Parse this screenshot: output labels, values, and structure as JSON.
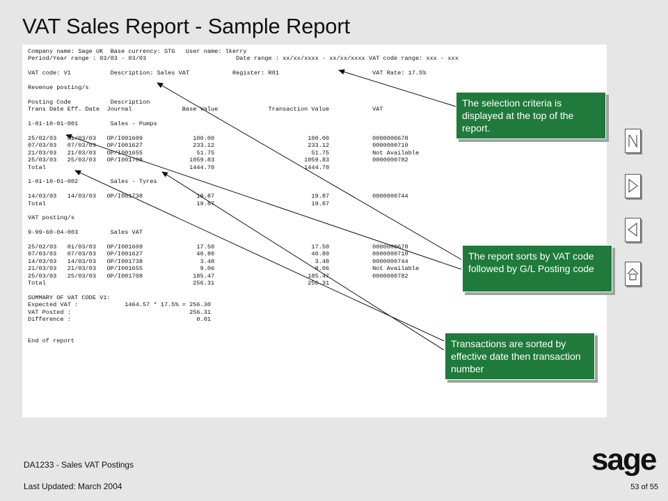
{
  "title": "VAT Sales Report - Sample Report",
  "report_lines": [
    "Company name: Sage UK  Base currency: STG   User name: lkerry",
    "Period/Year range : 03/03 - 03/03                         Date range : xx/xx/xxxx - xx/xx/xxxx VAT code range: xxx - xxx",
    "",
    "VAT code: V1           Description: Sales VAT            Register: R01                          VAT Rate: 17.5%",
    "",
    "Revenue posting/s",
    "",
    "Posting Code           Description",
    "Trans Date Eff. Date  Journal              Base Value              Transaction Value            VAT",
    "",
    "1-01-10-01-001         Sales - Pumps",
    "",
    "25/02/03   01/03/03   OP/I001609              100.00                          100.00            0000000678",
    "07/03/03   07/03/03   OP/I001627              233.12                          233.12            0000000710",
    "21/03/03   21/03/03   OP/I001655               51.75                           51.75            Not Available",
    "25/03/03   25/03/03   OP/I001708             1059.83                         1059.83            0000000782",
    "Total                                        1444.70                         1444.70",
    "",
    "1-01-10-01-002         Sales - Tyres",
    "",
    "14/03/03   14/03/03   OP/I001738               19.87                           19.87            0000000744",
    "Total                                          19.87                           19.87",
    "",
    "VAT posting/s",
    "",
    "9-99-60-04-003         Sales VAT",
    "",
    "25/02/03   01/03/03   OP/I001609               17.50                           17.50            0000000678",
    "07/03/03   07/03/03   OP/I001627               40.80                           40.80            0000000710",
    "14/03/03   14/03/03   OP/I001738                3.48                            3.48            0000000744",
    "21/03/03   21/03/03   OP/I001655                9.06                            9.06            Not Available",
    "25/03/03   25/03/03   OP/I001708              185.47                          185.47            0000000782",
    "Total                                         256.31                          256.31",
    "",
    "SUMMARY OF VAT CODE V1:",
    "Expected VAT :             1464.57 * 17.5% = 256.30",
    "VAT Posted :                                 256.31",
    "Difference :                                   0.01",
    "",
    "",
    "End of report"
  ],
  "callouts": {
    "selection": "The selection criteria is displayed at the top of the report.",
    "sorts_vat": "The report sorts by VAT code followed by G/L Posting code",
    "sorted_date": "Transactions are sorted by effective date then transaction number"
  },
  "nav": [
    "first-page-icon",
    "next-page-icon",
    "previous-page-icon",
    "home-icon"
  ],
  "footer": {
    "course": "DA1233 - Sales VAT Postings",
    "updated": "Last Updated:  March 2004",
    "page": "53 of 55",
    "logo": "sage"
  },
  "colors": {
    "callout_bg": "#1f7a3c",
    "background": "#e6e6e6"
  }
}
